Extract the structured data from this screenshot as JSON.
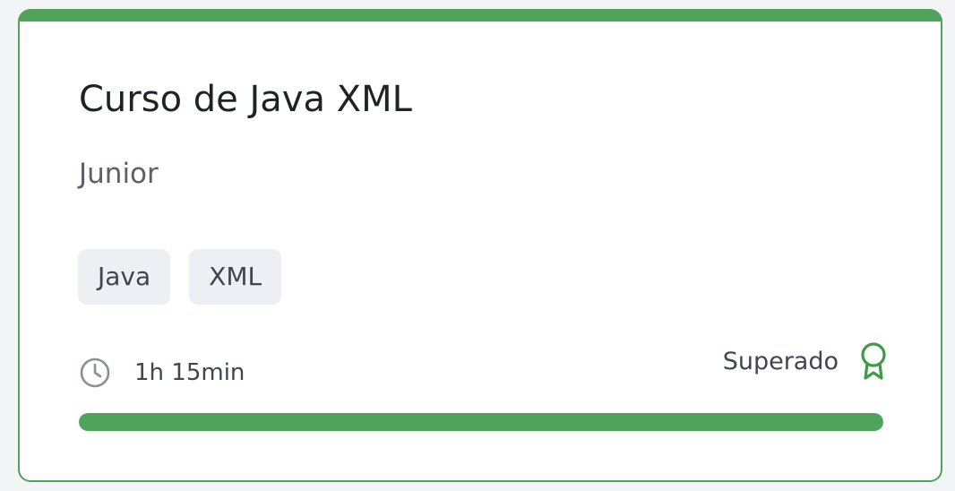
{
  "course": {
    "title": "Curso de Java XML",
    "level": "Junior",
    "tags": [
      "Java",
      "XML"
    ],
    "duration": "1h 15min",
    "status": "Superado",
    "progress": 1.0
  },
  "colors": {
    "accent": "#4fa35b",
    "tag_background": "#eceff4"
  },
  "icons": {
    "duration": "clock-icon",
    "status": "award-ribbon-icon"
  }
}
